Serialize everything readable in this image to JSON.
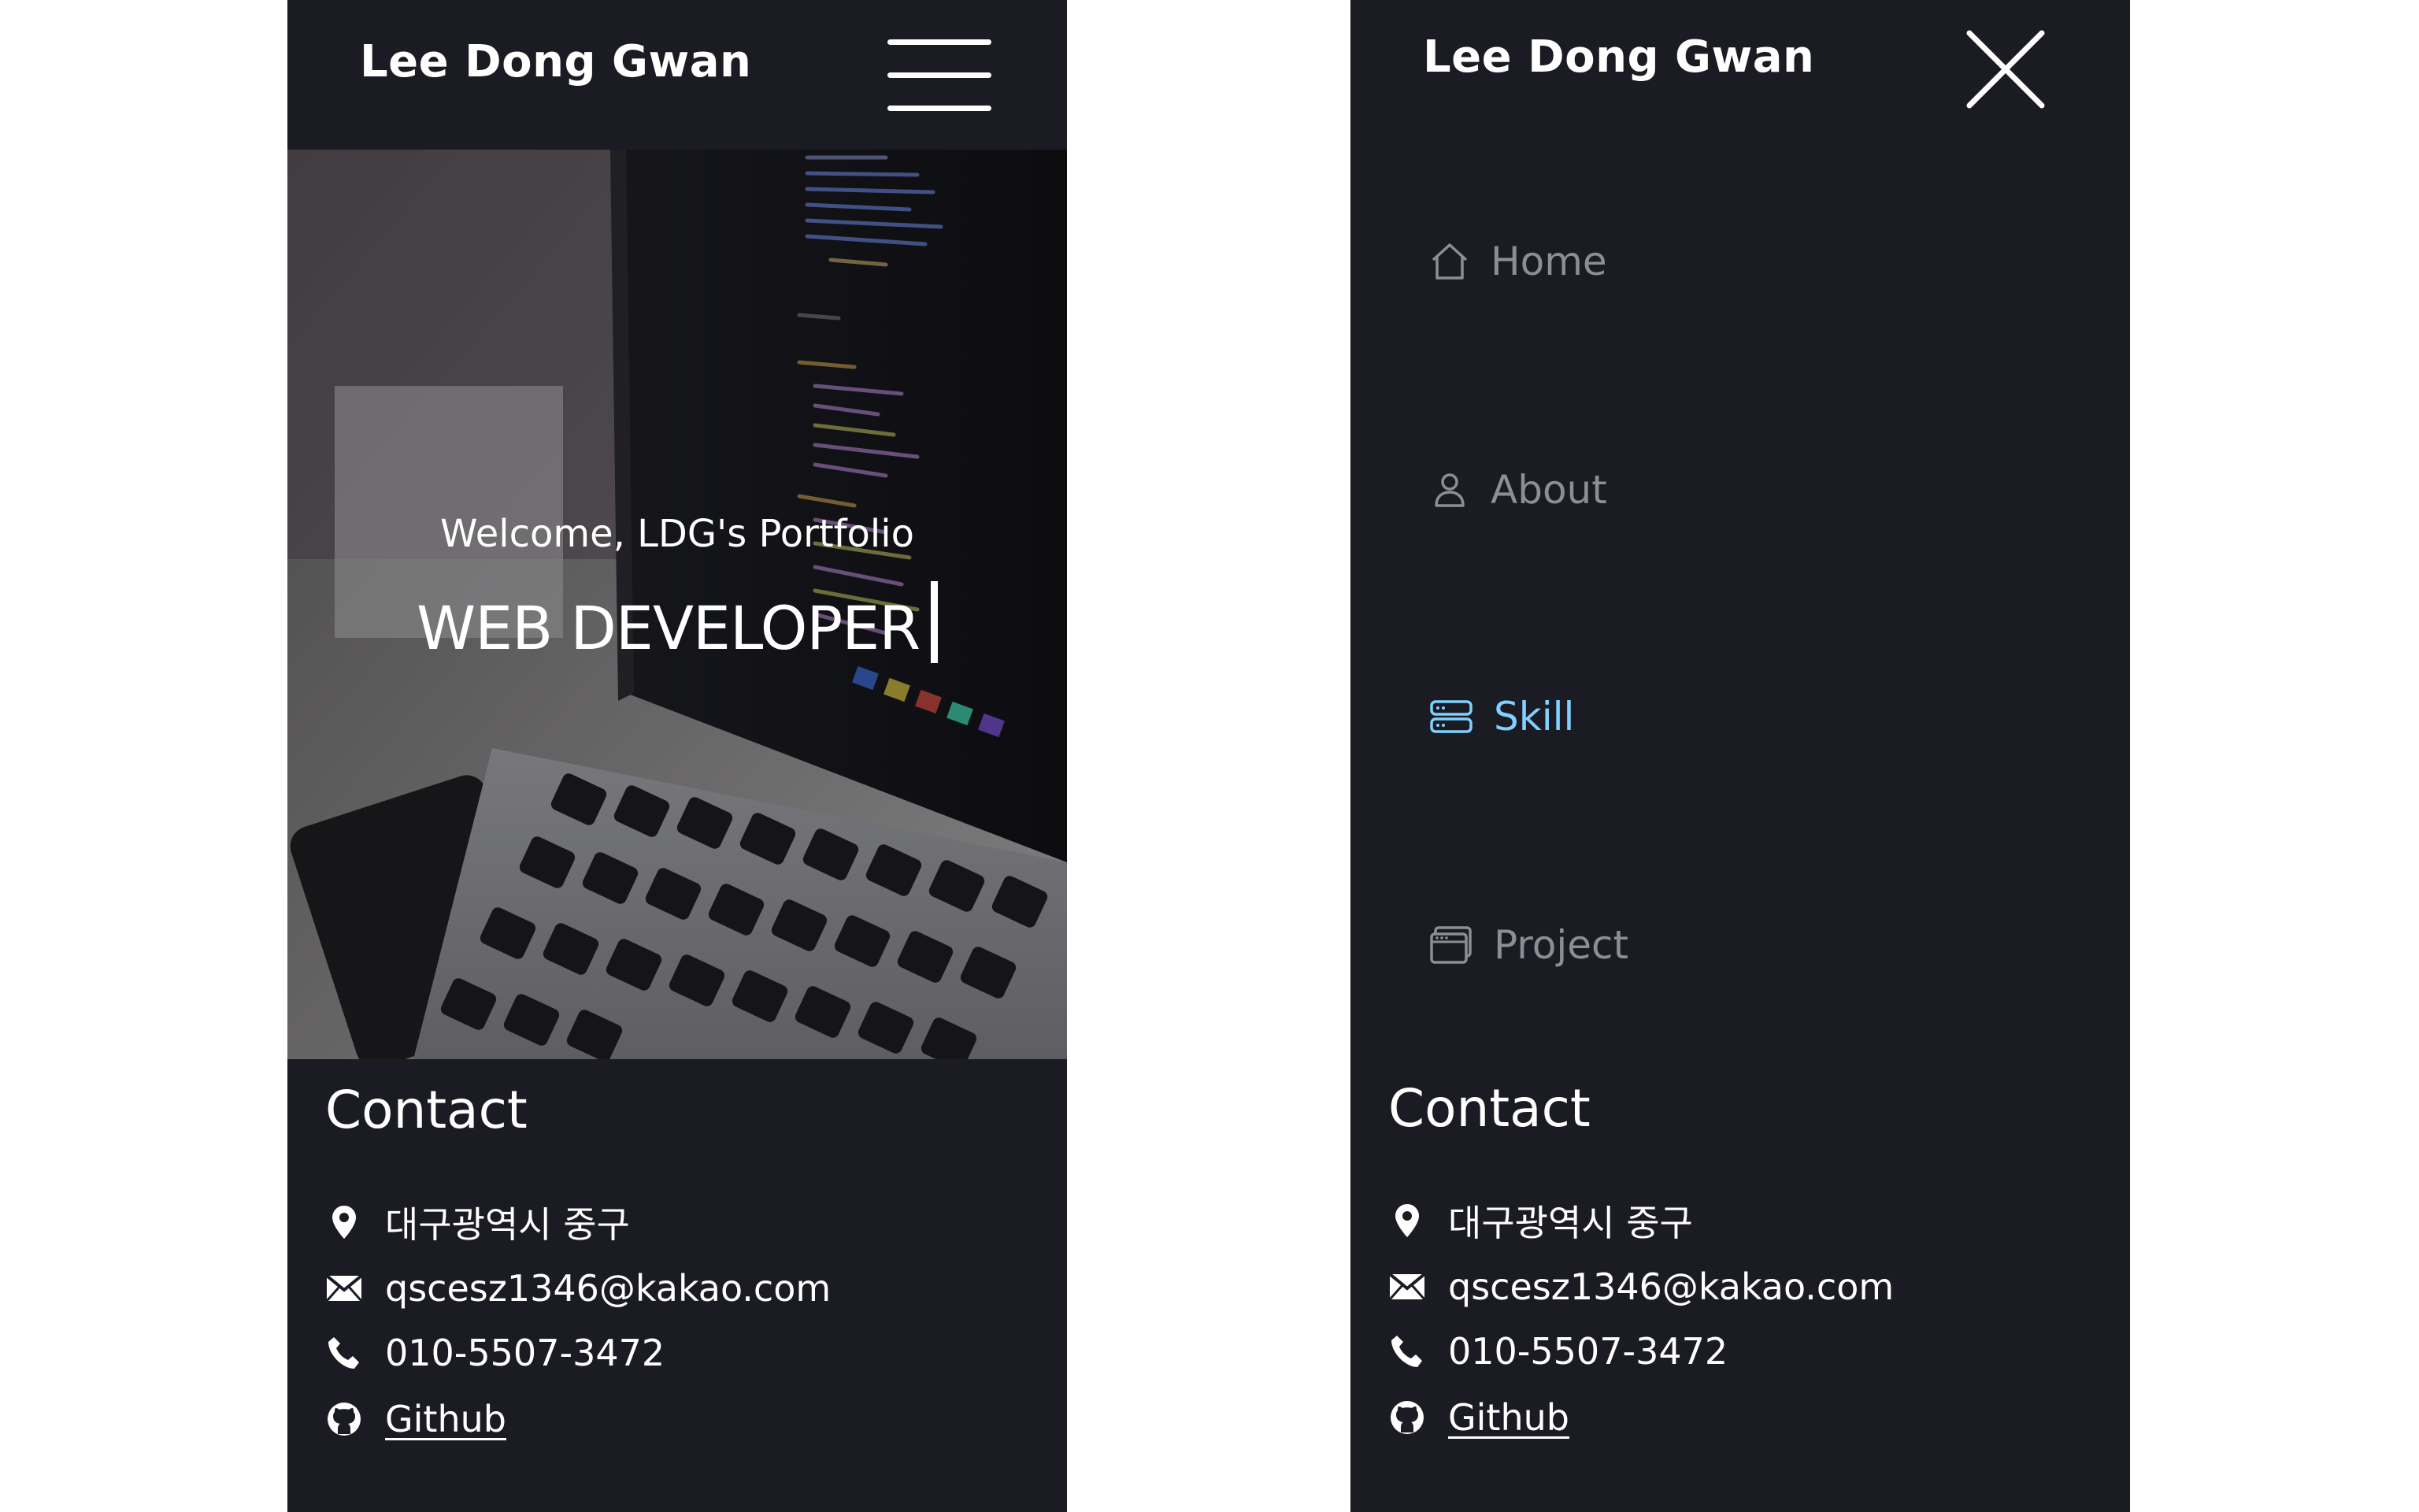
{
  "logo": "Lee Dong Gwan",
  "hero": {
    "welcome": "Welcome, LDG's Portfolio",
    "title": "WEB DEVELOPER"
  },
  "contact": {
    "heading": "Contact",
    "address": "대구광역시 중구",
    "email": "qscesz1346@kakao.com",
    "phone": "010-5507-3472",
    "github": "Github"
  },
  "menu": {
    "items": [
      {
        "label": "Home",
        "icon": "home-icon",
        "active": false
      },
      {
        "label": "About",
        "icon": "user-icon",
        "active": false
      },
      {
        "label": "Skill",
        "icon": "server-icon",
        "active": true
      },
      {
        "label": "Project",
        "icon": "window-icon",
        "active": false
      }
    ]
  },
  "colors": {
    "background": "#1b1b24",
    "text": "#ffffff",
    "menu_inactive": "#8d8e95",
    "menu_active": "#7fd1ff"
  }
}
